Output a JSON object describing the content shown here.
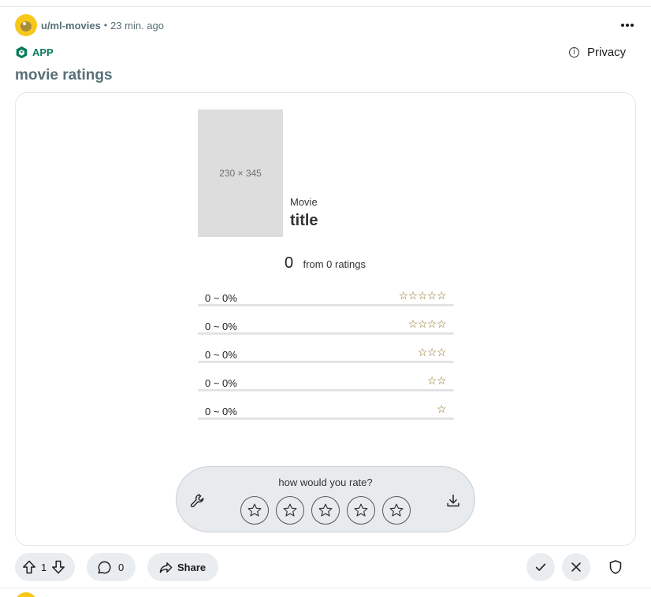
{
  "post": {
    "username": "u/ml-movies",
    "separator": "•",
    "time": "23 min. ago",
    "app_label": "APP",
    "privacy_label": "Privacy",
    "title": "movie ratings"
  },
  "movie": {
    "poster_placeholder": "230 × 345",
    "kicker": "Movie",
    "title": "title"
  },
  "score": {
    "value": "0",
    "suffix": "from 0 ratings"
  },
  "distribution": [
    {
      "label": "0 ~ 0%",
      "stars": "☆☆☆☆☆",
      "percent": 0
    },
    {
      "label": "0 ~ 0%",
      "stars": "☆☆☆☆",
      "percent": 0
    },
    {
      "label": "0 ~ 0%",
      "stars": "☆☆☆",
      "percent": 0
    },
    {
      "label": "0 ~ 0%",
      "stars": "☆☆",
      "percent": 0
    },
    {
      "label": "0 ~ 0%",
      "stars": "☆",
      "percent": 0
    }
  ],
  "rate_panel": {
    "question": "how would you rate?",
    "star_count": 5
  },
  "footer": {
    "upvotes": "1",
    "comments": "0",
    "share_label": "Share"
  },
  "colors": {
    "accent_green": "#0a7a5c",
    "star_gold": "#8a6d1c",
    "muted_text": "#576f76",
    "pill_bg": "#e9edef"
  },
  "icons": [
    "more-icon",
    "app-icon",
    "info-icon",
    "wrench-icon",
    "download-icon",
    "star-icon",
    "upvote-icon",
    "downvote-icon",
    "comment-icon",
    "share-icon",
    "check-icon",
    "close-icon",
    "shield-icon"
  ]
}
